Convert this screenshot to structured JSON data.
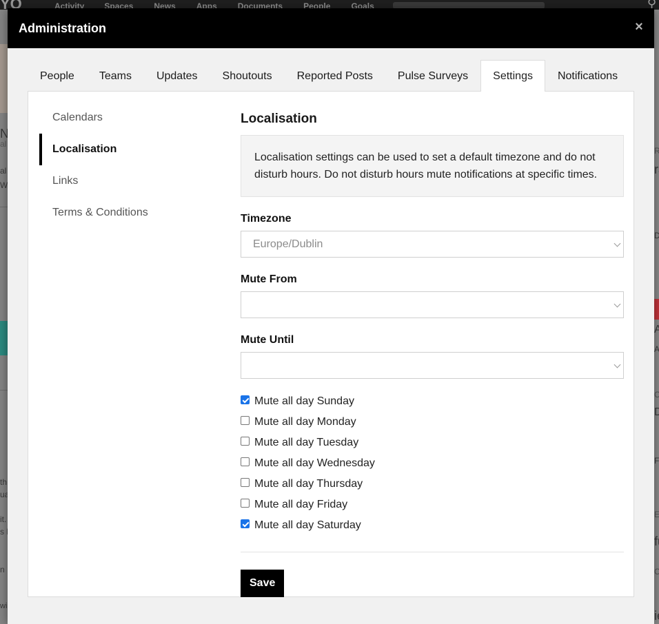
{
  "background": {
    "logo": "YO",
    "nav": [
      "Activity",
      "Spaces",
      "News",
      "Apps",
      "Documents",
      "People",
      "Goals"
    ],
    "left_fragments": [
      "Nc",
      "al",
      "al",
      "W",
      "th",
      "ua",
      "it.",
      "s li",
      "n",
      "wi"
    ],
    "right_fragments": [
      "R",
      "ra",
      "D",
      "A",
      "A",
      "C",
      "D",
      "F",
      "E",
      "fu",
      "C",
      "ie"
    ]
  },
  "modal": {
    "title": "Administration",
    "close_glyph": "×"
  },
  "tabs": [
    {
      "label": "People"
    },
    {
      "label": "Teams"
    },
    {
      "label": "Updates"
    },
    {
      "label": "Shoutouts"
    },
    {
      "label": "Reported Posts"
    },
    {
      "label": "Pulse Surveys"
    },
    {
      "label": "Settings",
      "active": true
    },
    {
      "label": "Notifications"
    }
  ],
  "side_nav": [
    {
      "label": "Calendars"
    },
    {
      "label": "Localisation",
      "active": true
    },
    {
      "label": "Links"
    },
    {
      "label": "Terms & Conditions"
    }
  ],
  "content": {
    "title": "Localisation",
    "info": "Localisation settings can be used to set a default timezone and do not disturb hours. Do not disturb hours mute notifications at specific times.",
    "timezone_label": "Timezone",
    "timezone_value": "Europe/Dublin",
    "mute_from_label": "Mute From",
    "mute_from_value": "",
    "mute_until_label": "Mute Until",
    "mute_until_value": "",
    "days": [
      {
        "label": "Mute all day Sunday",
        "checked": true
      },
      {
        "label": "Mute all day Monday",
        "checked": false
      },
      {
        "label": "Mute all day Tuesday",
        "checked": false
      },
      {
        "label": "Mute all day Wednesday",
        "checked": false
      },
      {
        "label": "Mute all day Thursday",
        "checked": false
      },
      {
        "label": "Mute all day Friday",
        "checked": false
      },
      {
        "label": "Mute all day Saturday",
        "checked": true
      }
    ],
    "save_label": "Save"
  },
  "colors": {
    "header_bg": "#000000",
    "accent_checkbox": "#1a73e8",
    "button_bg": "#000000"
  }
}
